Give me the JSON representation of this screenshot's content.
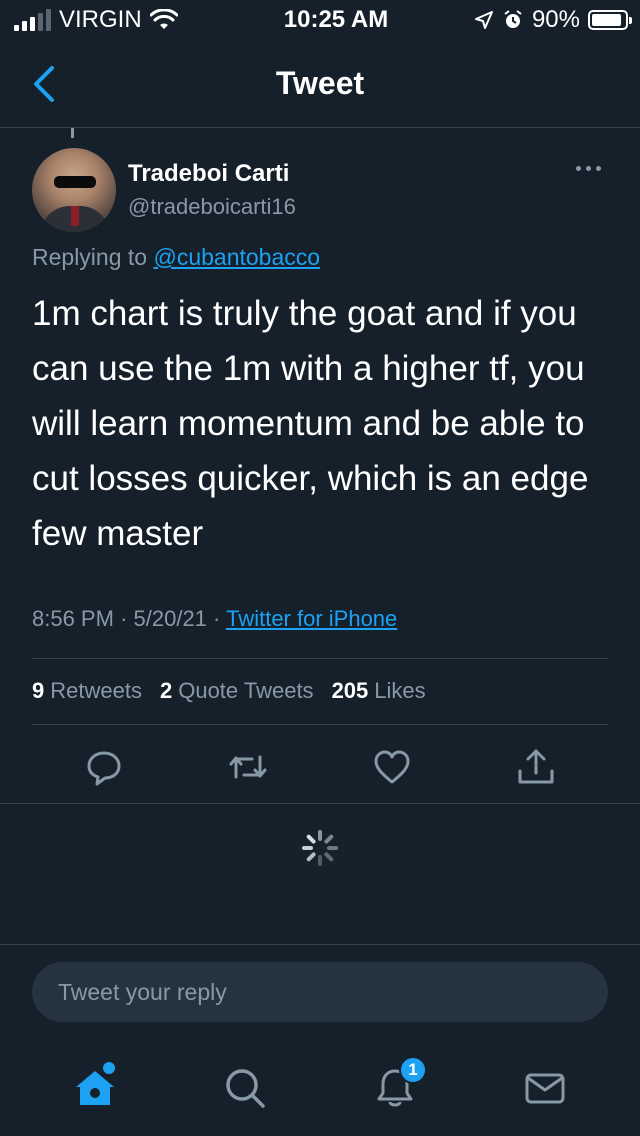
{
  "status_bar": {
    "carrier": "VIRGIN",
    "time": "10:25 AM",
    "battery_percent": "90%",
    "battery_level": 0.9
  },
  "nav": {
    "title": "Tweet"
  },
  "tweet": {
    "author_name": "Tradeboi Carti",
    "author_handle": "@tradeboicarti16",
    "replying_prefix": "Replying to",
    "replying_to": "@cubantobacco",
    "text": "1m chart is truly the goat and if you can use the 1m with a higher tf, you will learn momentum and be able to cut losses quicker, which is an edge few master",
    "time": "8:56 PM",
    "date": "5/20/21",
    "source": "Twitter for iPhone",
    "retweets_count": "9",
    "retweets_label": "Retweets",
    "quotes_count": "2",
    "quotes_label": "Quote Tweets",
    "likes_count": "205",
    "likes_label": "Likes"
  },
  "reply": {
    "placeholder": "Tweet your reply"
  },
  "tab_bar": {
    "notifications_badge": "1"
  },
  "colors": {
    "background": "#15202b",
    "accent": "#1da1f2",
    "muted": "#8899a6",
    "divider": "#38444d"
  }
}
